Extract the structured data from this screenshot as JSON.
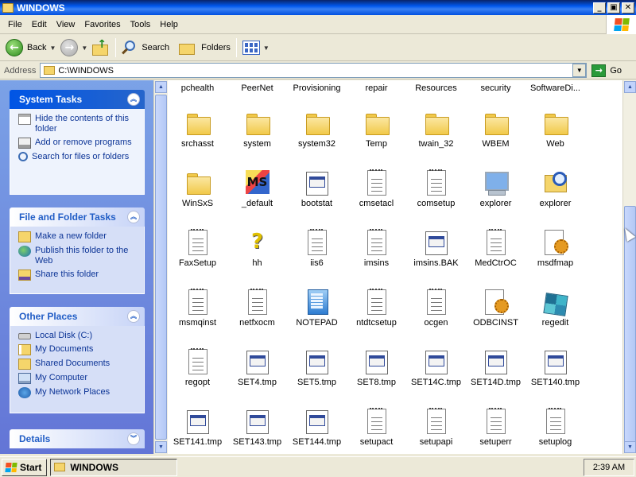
{
  "window": {
    "title": "WINDOWS",
    "min": "_",
    "max": "▣",
    "close": "✕"
  },
  "menu": {
    "items": [
      "File",
      "Edit",
      "View",
      "Favorites",
      "Tools",
      "Help"
    ]
  },
  "toolbar": {
    "back": "Back",
    "search": "Search",
    "folders": "Folders"
  },
  "address": {
    "label": "Address",
    "value": "C:\\WINDOWS",
    "go": "Go"
  },
  "left": {
    "system_tasks": {
      "title": "System Tasks",
      "items": [
        "Hide the contents of this folder",
        "Add or remove programs",
        "Search for files or folders"
      ]
    },
    "file_tasks": {
      "title": "File and Folder Tasks",
      "items": [
        "Make a new folder",
        "Publish this folder to the Web",
        "Share this folder"
      ]
    },
    "other_places": {
      "title": "Other Places",
      "items": [
        "Local Disk (C:)",
        "My Documents",
        "Shared Documents",
        "My Computer",
        "My Network Places"
      ]
    },
    "details": {
      "title": "Details"
    }
  },
  "files": [
    {
      "name": "pchealth",
      "icon": "none"
    },
    {
      "name": "PeerNet",
      "icon": "none"
    },
    {
      "name": "Provisioning",
      "icon": "none"
    },
    {
      "name": "repair",
      "icon": "none"
    },
    {
      "name": "Resources",
      "icon": "none"
    },
    {
      "name": "security",
      "icon": "none"
    },
    {
      "name": "SoftwareDi...",
      "icon": "none"
    },
    {
      "name": "srchasst",
      "icon": "folder-icon"
    },
    {
      "name": "system",
      "icon": "folder-icon"
    },
    {
      "name": "system32",
      "icon": "folder-icon"
    },
    {
      "name": "Temp",
      "icon": "folder-icon"
    },
    {
      "name": "twain_32",
      "icon": "folder-icon"
    },
    {
      "name": "WBEM",
      "icon": "folder-icon"
    },
    {
      "name": "Web",
      "icon": "folder-icon"
    },
    {
      "name": "WinSxS",
      "icon": "folder-icon"
    },
    {
      "name": "_default",
      "icon": "ms-icon"
    },
    {
      "name": "bootstat",
      "icon": "exe-icon"
    },
    {
      "name": "cmsetacl",
      "icon": "text-file-icon"
    },
    {
      "name": "comsetup",
      "icon": "text-file-icon"
    },
    {
      "name": "explorer",
      "icon": "computer-icon"
    },
    {
      "name": "explorer",
      "icon": "search-folder-icon"
    },
    {
      "name": "FaxSetup",
      "icon": "text-file-icon"
    },
    {
      "name": "hh",
      "icon": "help-icon"
    },
    {
      "name": "iis6",
      "icon": "text-file-icon"
    },
    {
      "name": "imsins",
      "icon": "text-file-icon"
    },
    {
      "name": "imsins.BAK",
      "icon": "exe-icon"
    },
    {
      "name": "MedCtrOC",
      "icon": "text-file-icon"
    },
    {
      "name": "msdfmap",
      "icon": "gear-file-icon"
    },
    {
      "name": "msmqinst",
      "icon": "text-file-icon"
    },
    {
      "name": "netfxocm",
      "icon": "text-file-icon"
    },
    {
      "name": "NOTEPAD",
      "icon": "notepad-icon"
    },
    {
      "name": "ntdtcsetup",
      "icon": "text-file-icon"
    },
    {
      "name": "ocgen",
      "icon": "text-file-icon"
    },
    {
      "name": "ODBCINST",
      "icon": "gear-file-icon"
    },
    {
      "name": "regedit",
      "icon": "regedit-icon"
    },
    {
      "name": "regopt",
      "icon": "text-file-icon"
    },
    {
      "name": "SET4.tmp",
      "icon": "exe-icon"
    },
    {
      "name": "SET5.tmp",
      "icon": "exe-icon"
    },
    {
      "name": "SET8.tmp",
      "icon": "exe-icon"
    },
    {
      "name": "SET14C.tmp",
      "icon": "exe-icon"
    },
    {
      "name": "SET14D.tmp",
      "icon": "exe-icon"
    },
    {
      "name": "SET140.tmp",
      "icon": "exe-icon"
    },
    {
      "name": "SET141.tmp",
      "icon": "exe-icon"
    },
    {
      "name": "SET143.tmp",
      "icon": "exe-icon"
    },
    {
      "name": "SET144.tmp",
      "icon": "exe-icon"
    },
    {
      "name": "setupact",
      "icon": "text-file-icon"
    },
    {
      "name": "setupapi",
      "icon": "text-file-icon"
    },
    {
      "name": "setuperr",
      "icon": "text-file-icon"
    },
    {
      "name": "setuplog",
      "icon": "text-file-icon"
    }
  ],
  "taskbar": {
    "start": "Start",
    "window": "WINDOWS",
    "clock": "2:39 AM"
  }
}
